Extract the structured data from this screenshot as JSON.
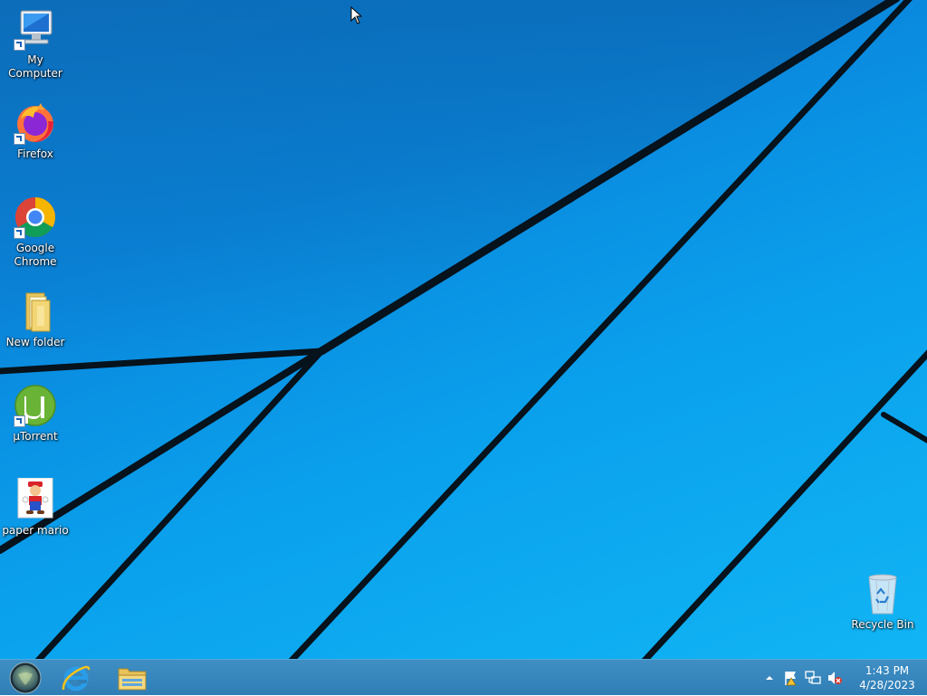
{
  "desktop": {
    "icons": [
      {
        "label": "My Computer",
        "icon": "computer-icon",
        "shortcut": true
      },
      {
        "label": "Firefox",
        "icon": "firefox-icon",
        "shortcut": true
      },
      {
        "label": "Google Chrome",
        "icon": "chrome-icon",
        "shortcut": true
      },
      {
        "label": "New folder",
        "icon": "folder-icon",
        "shortcut": false
      },
      {
        "label": "µTorrent",
        "icon": "utorrent-icon",
        "shortcut": true
      },
      {
        "label": "paper mario",
        "icon": "paper-mario-image-icon",
        "shortcut": false
      }
    ],
    "recycle_bin": {
      "label": "Recycle Bin",
      "icon": "recycle-bin-icon"
    }
  },
  "taskbar": {
    "start_icon": "start-orb-icon",
    "pinned": [
      {
        "name": "Internet Explorer",
        "icon": "internet-explorer-icon"
      },
      {
        "name": "File Explorer",
        "icon": "file-explorer-icon"
      }
    ],
    "tray": {
      "icons": [
        "show-hidden-icons-chevron",
        "action-center-flag-icon",
        "network-icon",
        "volume-muted-icon"
      ],
      "time": "1:43 PM",
      "date": "4/28/2023"
    }
  },
  "colors": {
    "wallpaper_blue": "#0a96e6",
    "taskbar": "#3483bb"
  }
}
